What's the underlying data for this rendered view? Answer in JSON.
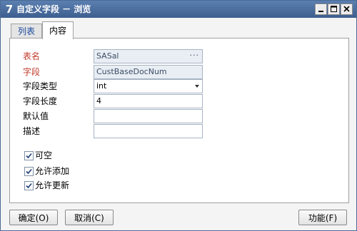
{
  "window": {
    "app_icon_glyph": "7",
    "title": "自定义字段 － 浏览"
  },
  "tabs": [
    {
      "label": "列表",
      "active": false
    },
    {
      "label": "内容",
      "active": true
    }
  ],
  "form": {
    "table_name": {
      "label": "表名",
      "value": "SASal",
      "required": true
    },
    "field": {
      "label": "字段",
      "value": "CustBaseDocNum",
      "required": true
    },
    "field_type": {
      "label": "字段类型",
      "value": "int"
    },
    "field_length": {
      "label": "字段长度",
      "value": "4"
    },
    "default_value": {
      "label": "默认值",
      "value": ""
    },
    "description": {
      "label": "描述",
      "value": ""
    }
  },
  "checkboxes": [
    {
      "label": "可空",
      "checked": true
    },
    {
      "label": "允许添加",
      "checked": true
    },
    {
      "label": "允许更新",
      "checked": true
    }
  ],
  "buttons": {
    "ok": "确定(O)",
    "cancel": "取消(C)",
    "function": "功能(F)"
  },
  "colors": {
    "titlebar": "#4a6fa0",
    "required_label": "#c0392b",
    "inactive_tab_text": "#1e4a9e"
  }
}
